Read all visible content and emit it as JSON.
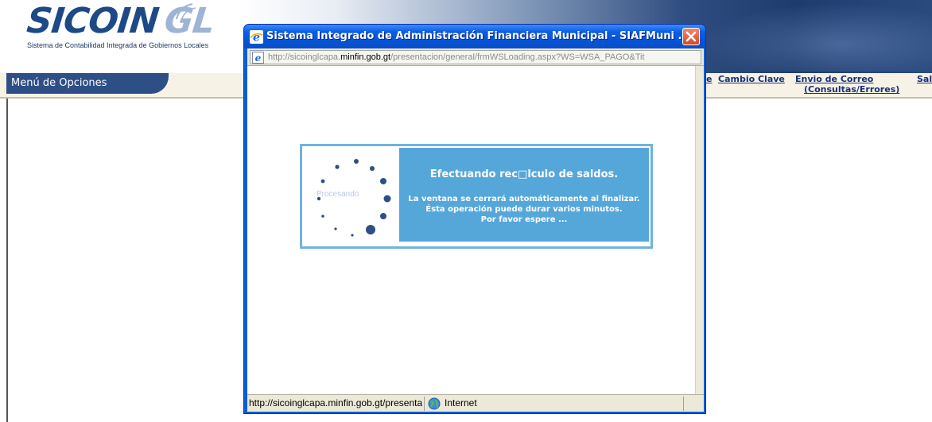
{
  "app": {
    "logo": "SICOIN GL",
    "subtitle": "Sistema de Contabilidad Integrada de Gobiernos Locales",
    "menu_title": "Menú de Opciones",
    "links": {
      "partial": "e",
      "cambio_clave": "Cambio Clave",
      "envio_line1": "Envio de Correo",
      "envio_line2": "(Consultas/Errores)",
      "salir": "Salir"
    }
  },
  "popup": {
    "title": "Sistema Integrado de Administración Financiera Municipal - SIAFMuni ...",
    "address": {
      "prefix": "http://sicoinglcapa.",
      "domain": "minfin.gob.gt",
      "suffix": "/presentacion/general/frmWSLoading.aspx?WS=WSA_PAGO&Tit"
    },
    "loading": {
      "spinner_label": "Procesando",
      "title": "Efectuando rec□lculo de saldos.",
      "line1": "La ventana se cerrará automáticamente al finalizar.",
      "line2": "Ésta operación puede durar varios minutos.",
      "line3": "Por favor espere ..."
    },
    "status": {
      "url": "http://sicoinglcapa.minfin.gob.gt/presentacion/general/frmWSLoading.aspx",
      "zone": "Internet"
    }
  },
  "colors": {
    "titlebar": "#0b5ee6",
    "message_panel": "#55a7da",
    "panel_border": "#6fb3de",
    "menu_tab": "#2d4f86",
    "link": "#1a2f7a"
  },
  "icons": [
    "ie-icon",
    "close-icon",
    "globe-icon",
    "spinner-icon"
  ]
}
